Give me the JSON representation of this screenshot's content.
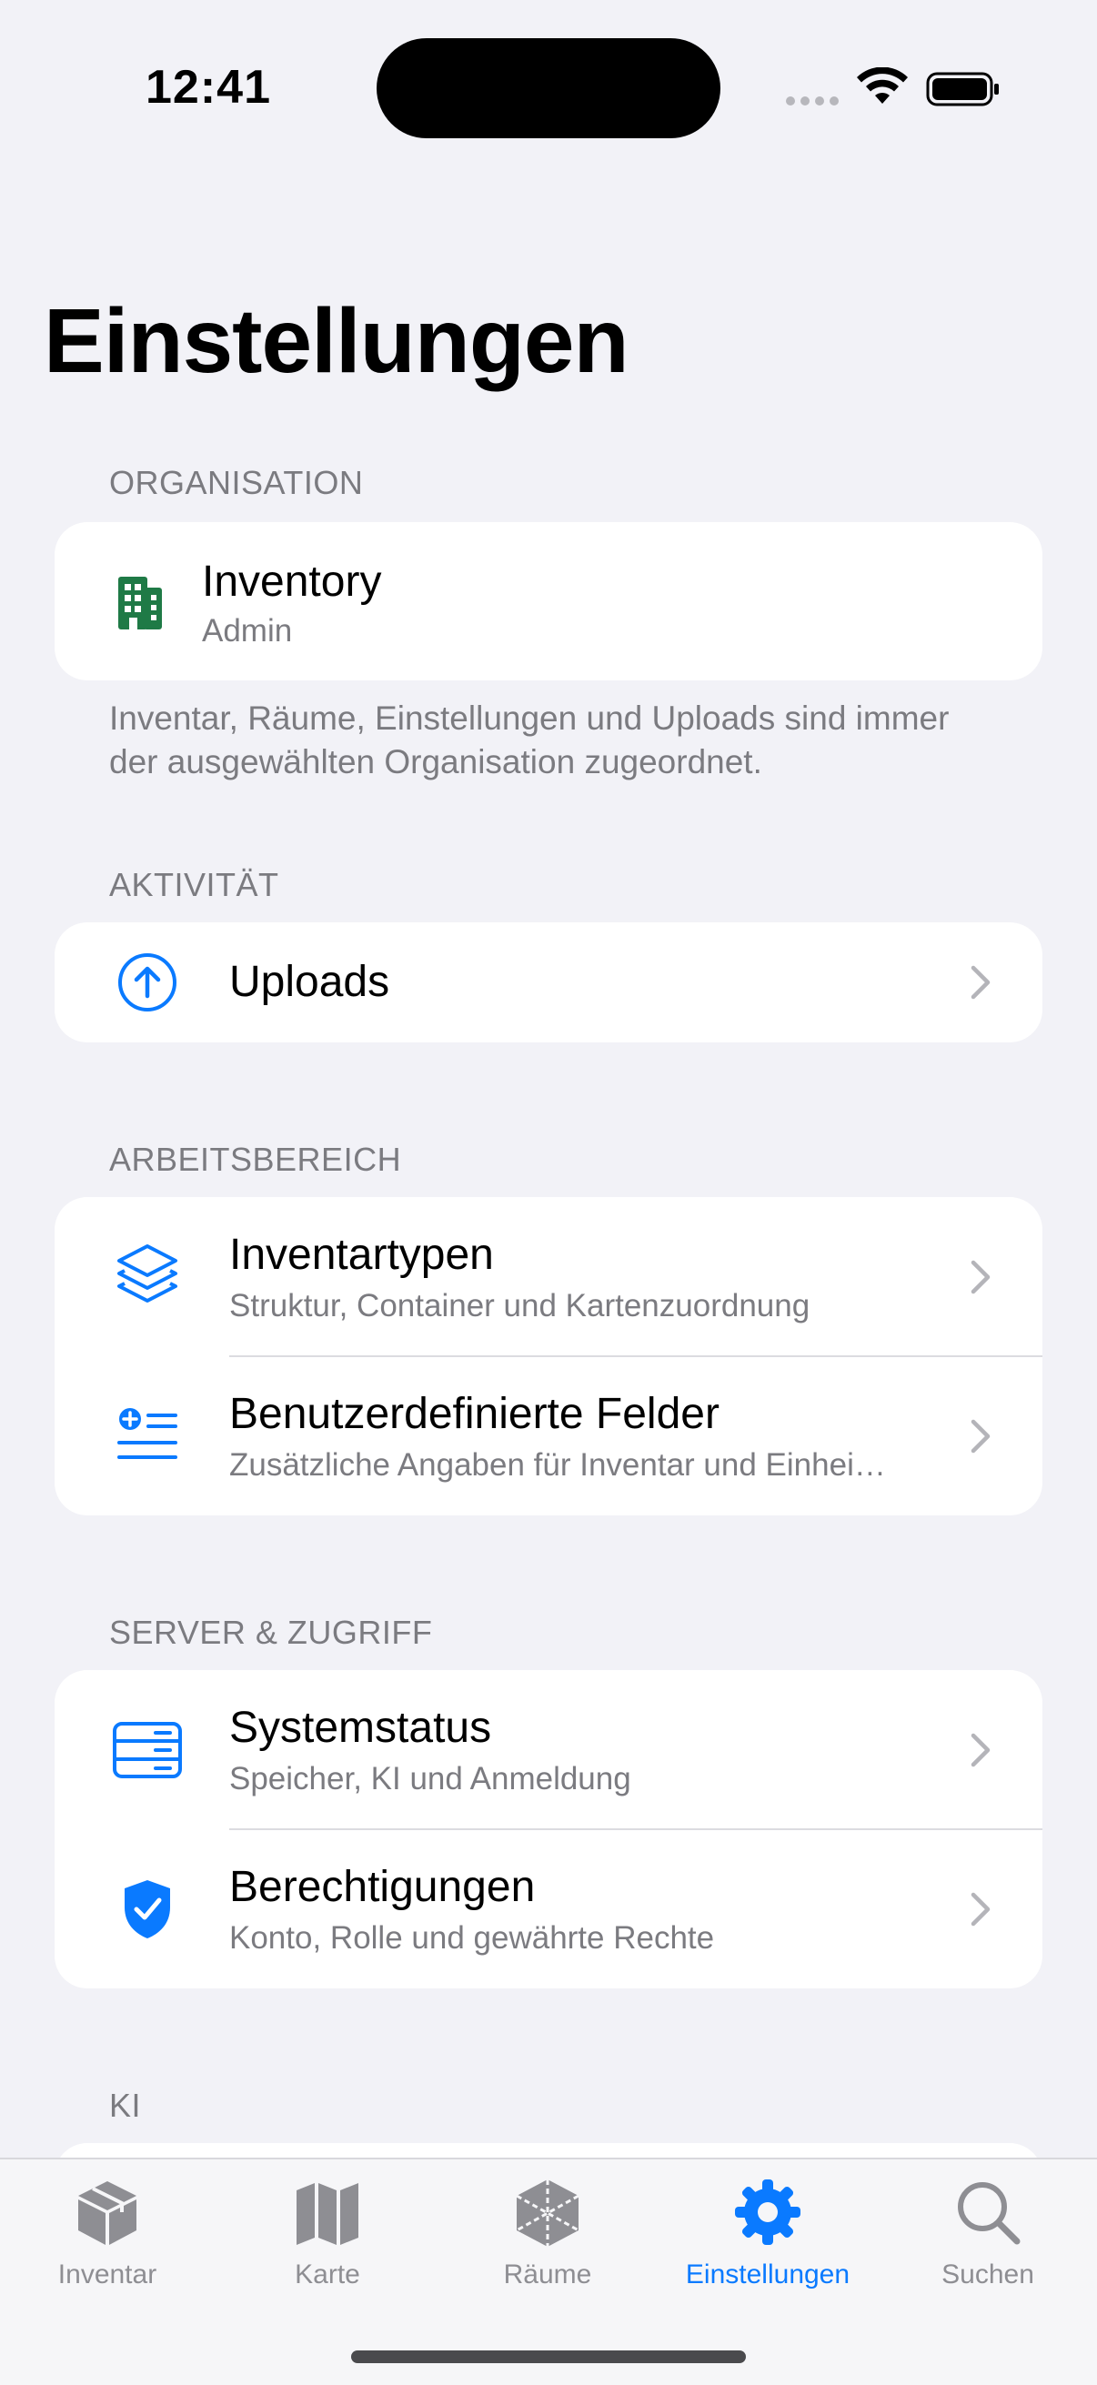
{
  "status_bar": {
    "time": "12:41"
  },
  "page": {
    "title": "Einstellungen"
  },
  "sections": {
    "organisation": {
      "header": "ORGANISATION",
      "org_name": "Inventory",
      "org_role": "Admin",
      "footnote": "Inventar, Räume, Einstellungen und Uploads sind immer der ausgewählten Organisation zugeordnet."
    },
    "activity": {
      "header": "AKTIVITÄT",
      "uploads_label": "Uploads"
    },
    "workspace": {
      "header": "ARBEITSBEREICH",
      "items": [
        {
          "title": "Inventartypen",
          "subtitle": "Struktur, Container und Kartenzuordnung",
          "icon": "layers-icon"
        },
        {
          "title": "Benutzerdefinierte Felder",
          "subtitle": "Zusätzliche Angaben für Inventar und Einhei…",
          "icon": "custom-fields-icon"
        }
      ]
    },
    "server": {
      "header": "SERVER & ZUGRIFF",
      "items": [
        {
          "title": "Systemstatus",
          "subtitle": "Speicher, KI und Anmeldung",
          "icon": "server-icon"
        },
        {
          "title": "Berechtigungen",
          "subtitle": "Konto, Rolle und gewährte Rechte",
          "icon": "shield-check-icon"
        }
      ]
    },
    "ai": {
      "header": "KI"
    }
  },
  "tab_bar": {
    "tabs": [
      {
        "label": "Inventar",
        "icon": "box-icon",
        "active": false
      },
      {
        "label": "Karte",
        "icon": "map-icon",
        "active": false
      },
      {
        "label": "Räume",
        "icon": "room-icon",
        "active": false
      },
      {
        "label": "Einstellungen",
        "icon": "gear-icon",
        "active": true
      },
      {
        "label": "Suchen",
        "icon": "search-icon",
        "active": false
      }
    ]
  },
  "colors": {
    "accent": "#0a7aff",
    "org_icon": "#1f7a46",
    "background": "#f2f2f7",
    "secondary_text": "#7b7b80"
  }
}
